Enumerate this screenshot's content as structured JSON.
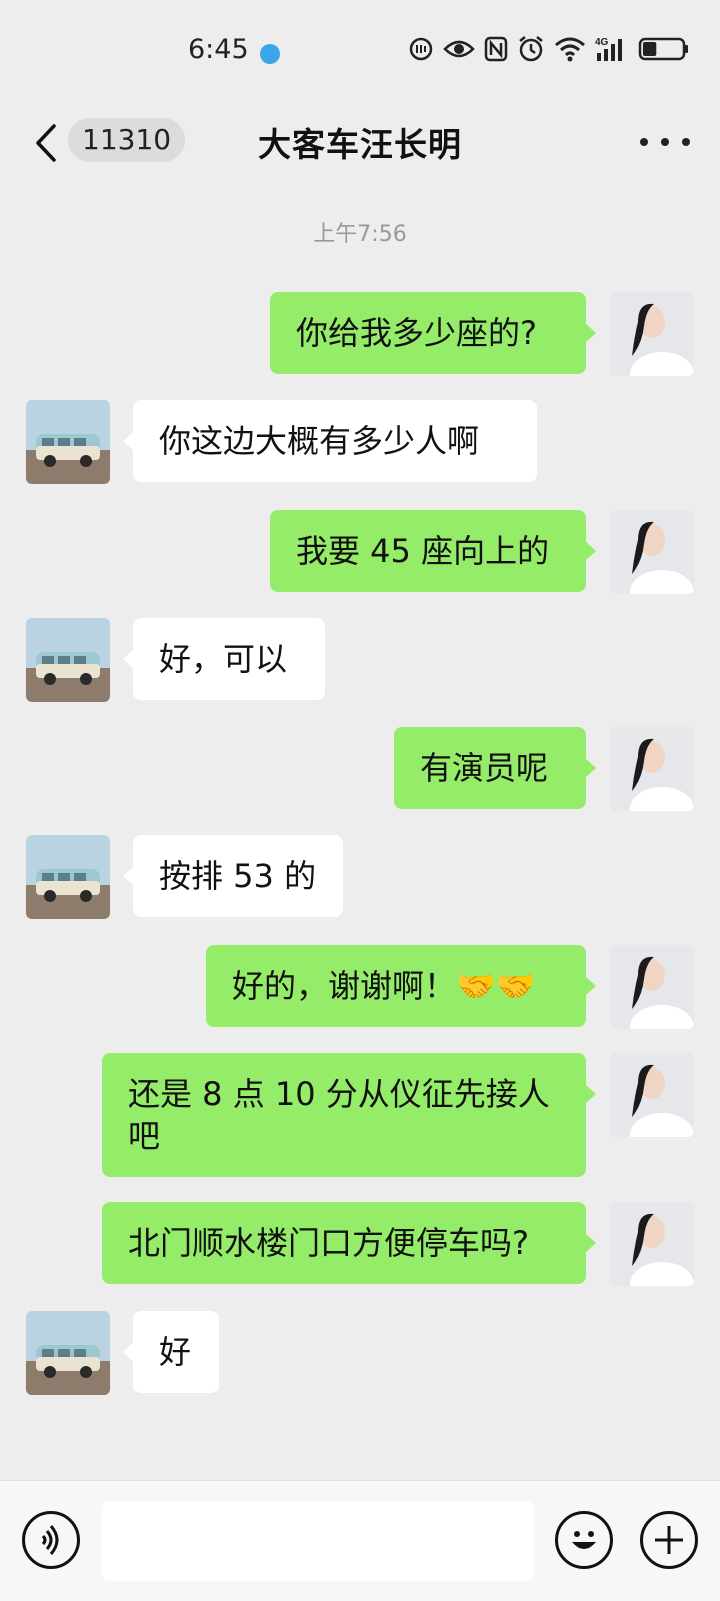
{
  "status_bar": {
    "time": "6:45",
    "network": "4G",
    "icons": [
      "app-notification-icon",
      "hd-call-icon",
      "eye-icon",
      "nfc-icon",
      "alarm-icon",
      "wifi-icon",
      "signal-icon",
      "battery-icon"
    ],
    "battery_level": 0.35
  },
  "nav": {
    "back_icon": "chevron-left-icon",
    "unread_count": "11310",
    "title": "大客车汪长明",
    "more_icon": "more-dots-icon"
  },
  "timestamp": "上午7:56",
  "messages": [
    {
      "direction": "out",
      "text": "你给我多少座的?"
    },
    {
      "direction": "in",
      "text": "你这边大概有多少人啊"
    },
    {
      "direction": "out",
      "text": "我要 45 座向上的"
    },
    {
      "direction": "in",
      "text": "好，可以"
    },
    {
      "direction": "out",
      "text": "有演员呢"
    },
    {
      "direction": "in",
      "text": "按排 53 的"
    },
    {
      "direction": "out",
      "text": "好的，谢谢啊！🤝🤝"
    },
    {
      "direction": "out",
      "text": "还是 8 点 10 分从仪征先接人吧"
    },
    {
      "direction": "out",
      "text": "北门顺水楼门口方便停车吗?"
    },
    {
      "direction": "in",
      "text": "好"
    }
  ],
  "input_bar": {
    "voice_icon": "voice-icon",
    "input_value": "",
    "emoji_icon": "emoji-icon",
    "plus_icon": "plus-icon"
  },
  "colors": {
    "background": "#ededed",
    "outgoing_bubble": "#95ec69",
    "incoming_bubble": "#ffffff"
  }
}
